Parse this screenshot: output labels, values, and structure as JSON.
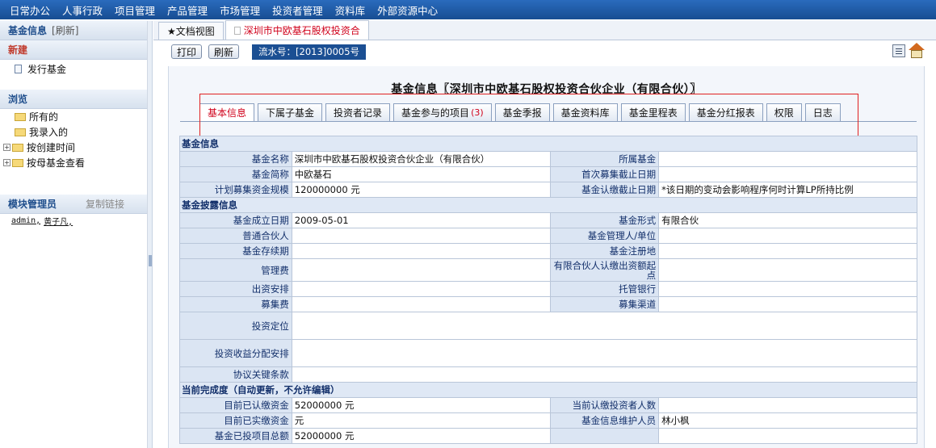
{
  "topnav": [
    "日常办公",
    "人事行政",
    "项目管理",
    "产品管理",
    "市场管理",
    "投资者管理",
    "资料库",
    "外部资源中心"
  ],
  "sidebar": {
    "title": "基金信息",
    "refresh": "[刷新]",
    "new_section": "新建",
    "new_items": [
      "发行基金"
    ],
    "browse_section": "浏览",
    "browse_items": [
      "所有的",
      "我录入的",
      "按创建时间",
      "按母基金查看"
    ],
    "admin_section": "模块管理员",
    "copy_link": "复制链接",
    "admins": [
      "admin,",
      "黄子凡,"
    ]
  },
  "doc_tabs": [
    "★文档视图",
    "深圳市中欧基石股权投资合"
  ],
  "toolbar": {
    "print": "打印",
    "refresh": "刷新",
    "serial": "流水号：[2013]0005号"
  },
  "doc_title": "基金信息〖深圳市中欧基石股权投资合伙企业（有限合伙）〗",
  "fund_tabs": [
    {
      "label": "基本信息"
    },
    {
      "label": "下属子基金"
    },
    {
      "label": "投资者记录"
    },
    {
      "label": "基金参与的项目",
      "count": "(3)"
    },
    {
      "label": "基金季报"
    },
    {
      "label": "基金资料库"
    },
    {
      "label": "基金里程表"
    },
    {
      "label": "基金分红报表"
    },
    {
      "label": "权限"
    },
    {
      "label": "日志"
    }
  ],
  "form": {
    "section1": "基金信息",
    "fund_name_label": "基金名称",
    "fund_name": "深圳市中欧基石股权投资合伙企业（有限合伙）",
    "parent_fund_label": "所属基金",
    "short_name_label": "基金简称",
    "short_name": "中欧基石",
    "first_raise_deadline_label": "首次募集截止日期",
    "planned_size_label": "计划募集资金规模",
    "planned_size": "120000000 元",
    "subscribe_deadline_label": "基金认缴截止日期",
    "subscribe_deadline_note": "*该日期的变动会影响程序何时计算LP所持比例",
    "section2": "基金披露信息",
    "established_label": "基金成立日期",
    "established": "2009-05-01",
    "fund_form_label": "基金形式",
    "fund_form": "有限合伙",
    "gp_label": "普通合伙人",
    "manager_label": "基金管理人/单位",
    "duration_label": "基金存续期",
    "registered_label": "基金注册地",
    "mgmt_fee_label": "管理费",
    "lp_min_label": "有限合伙人认缴出资额起点",
    "capital_arrangement_label": "出资安排",
    "custodian_label": "托管银行",
    "raise_fee_label": "募集费",
    "raise_channel_label": "募集渠道",
    "positioning_label": "投资定位",
    "distribution_label": "投资收益分配安排",
    "key_terms_label": "协议关键条款",
    "section3": "当前完成度（自动更新，不允许编辑）",
    "subscribed_label": "目前已认缴资金",
    "subscribed": "52000000 元",
    "investor_count_label": "当前认缴投资者人数",
    "paid_label": "目前已实缴资金",
    "paid": "元",
    "maintainer_label": "基金信息维护人员",
    "maintainer": "林小枫",
    "invested_total_label": "基金已投项目总额",
    "invested_total": "52000000 元"
  }
}
